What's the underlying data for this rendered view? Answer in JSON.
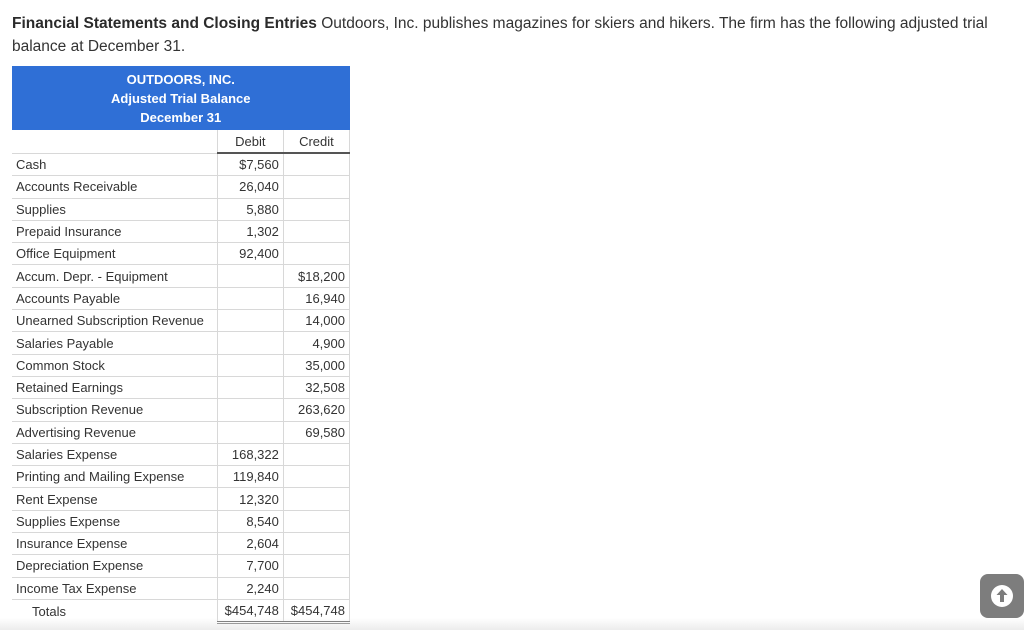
{
  "intro": {
    "lead": "Financial Statements and Closing Entries",
    "text": " Outdoors, Inc. publishes magazines for skiers and hikers. The firm has the following adjusted trial balance at December 31."
  },
  "table": {
    "company": "OUTDOORS, INC.",
    "title": "Adjusted Trial Balance",
    "date": "December 31",
    "debit_header": "Debit",
    "credit_header": "Credit",
    "rows": [
      {
        "account": "Cash",
        "debit": "$7,560",
        "credit": ""
      },
      {
        "account": "Accounts Receivable",
        "debit": "26,040",
        "credit": ""
      },
      {
        "account": "Supplies",
        "debit": "5,880",
        "credit": ""
      },
      {
        "account": "Prepaid Insurance",
        "debit": "1,302",
        "credit": ""
      },
      {
        "account": "Office Equipment",
        "debit": "92,400",
        "credit": ""
      },
      {
        "account": "Accum. Depr. - Equipment",
        "debit": "",
        "credit": "$18,200"
      },
      {
        "account": "Accounts Payable",
        "debit": "",
        "credit": "16,940"
      },
      {
        "account": "Unearned Subscription Revenue",
        "debit": "",
        "credit": "14,000"
      },
      {
        "account": "Salaries Payable",
        "debit": "",
        "credit": "4,900"
      },
      {
        "account": "Common Stock",
        "debit": "",
        "credit": "35,000"
      },
      {
        "account": "Retained Earnings",
        "debit": "",
        "credit": "32,508"
      },
      {
        "account": "Subscription Revenue",
        "debit": "",
        "credit": "263,620"
      },
      {
        "account": "Advertising Revenue",
        "debit": "",
        "credit": "69,580"
      },
      {
        "account": "Salaries Expense",
        "debit": "168,322",
        "credit": ""
      },
      {
        "account": "Printing and Mailing Expense",
        "debit": "119,840",
        "credit": ""
      },
      {
        "account": "Rent Expense",
        "debit": "12,320",
        "credit": ""
      },
      {
        "account": "Supplies Expense",
        "debit": "8,540",
        "credit": ""
      },
      {
        "account": "Insurance Expense",
        "debit": "2,604",
        "credit": ""
      },
      {
        "account": "Depreciation Expense",
        "debit": "7,700",
        "credit": ""
      },
      {
        "account": "Income Tax Expense",
        "debit": "2,240",
        "credit": ""
      }
    ],
    "totals": {
      "label": "Totals",
      "debit": "$454,748",
      "credit": "$454,748"
    }
  },
  "scroll_button": {
    "icon": "arrow-up-icon",
    "bg": "#7d7d7d"
  },
  "colors": {
    "header_bg": "#2f6fd6",
    "text": "#333333"
  }
}
